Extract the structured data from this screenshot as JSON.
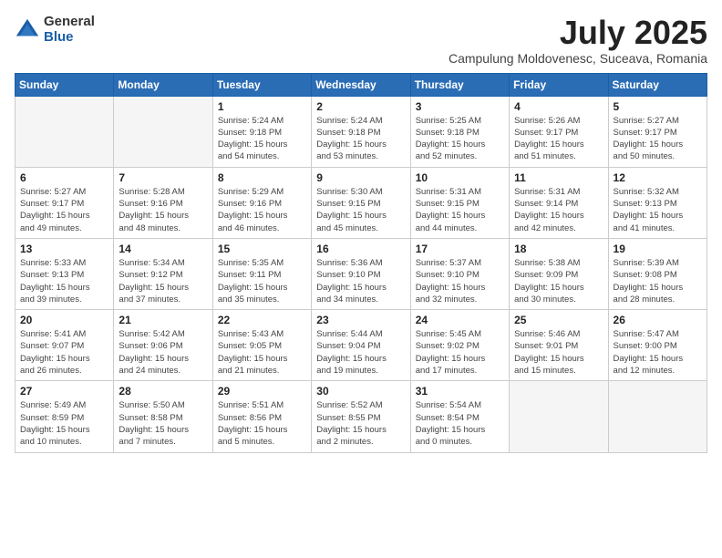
{
  "logo": {
    "general": "General",
    "blue": "Blue"
  },
  "title": "July 2025",
  "subtitle": "Campulung Moldovenesc, Suceava, Romania",
  "weekdays": [
    "Sunday",
    "Monday",
    "Tuesday",
    "Wednesday",
    "Thursday",
    "Friday",
    "Saturday"
  ],
  "weeks": [
    [
      {
        "day": "",
        "info": ""
      },
      {
        "day": "",
        "info": ""
      },
      {
        "day": "1",
        "info": "Sunrise: 5:24 AM\nSunset: 9:18 PM\nDaylight: 15 hours\nand 54 minutes."
      },
      {
        "day": "2",
        "info": "Sunrise: 5:24 AM\nSunset: 9:18 PM\nDaylight: 15 hours\nand 53 minutes."
      },
      {
        "day": "3",
        "info": "Sunrise: 5:25 AM\nSunset: 9:18 PM\nDaylight: 15 hours\nand 52 minutes."
      },
      {
        "day": "4",
        "info": "Sunrise: 5:26 AM\nSunset: 9:17 PM\nDaylight: 15 hours\nand 51 minutes."
      },
      {
        "day": "5",
        "info": "Sunrise: 5:27 AM\nSunset: 9:17 PM\nDaylight: 15 hours\nand 50 minutes."
      }
    ],
    [
      {
        "day": "6",
        "info": "Sunrise: 5:27 AM\nSunset: 9:17 PM\nDaylight: 15 hours\nand 49 minutes."
      },
      {
        "day": "7",
        "info": "Sunrise: 5:28 AM\nSunset: 9:16 PM\nDaylight: 15 hours\nand 48 minutes."
      },
      {
        "day": "8",
        "info": "Sunrise: 5:29 AM\nSunset: 9:16 PM\nDaylight: 15 hours\nand 46 minutes."
      },
      {
        "day": "9",
        "info": "Sunrise: 5:30 AM\nSunset: 9:15 PM\nDaylight: 15 hours\nand 45 minutes."
      },
      {
        "day": "10",
        "info": "Sunrise: 5:31 AM\nSunset: 9:15 PM\nDaylight: 15 hours\nand 44 minutes."
      },
      {
        "day": "11",
        "info": "Sunrise: 5:31 AM\nSunset: 9:14 PM\nDaylight: 15 hours\nand 42 minutes."
      },
      {
        "day": "12",
        "info": "Sunrise: 5:32 AM\nSunset: 9:13 PM\nDaylight: 15 hours\nand 41 minutes."
      }
    ],
    [
      {
        "day": "13",
        "info": "Sunrise: 5:33 AM\nSunset: 9:13 PM\nDaylight: 15 hours\nand 39 minutes."
      },
      {
        "day": "14",
        "info": "Sunrise: 5:34 AM\nSunset: 9:12 PM\nDaylight: 15 hours\nand 37 minutes."
      },
      {
        "day": "15",
        "info": "Sunrise: 5:35 AM\nSunset: 9:11 PM\nDaylight: 15 hours\nand 35 minutes."
      },
      {
        "day": "16",
        "info": "Sunrise: 5:36 AM\nSunset: 9:10 PM\nDaylight: 15 hours\nand 34 minutes."
      },
      {
        "day": "17",
        "info": "Sunrise: 5:37 AM\nSunset: 9:10 PM\nDaylight: 15 hours\nand 32 minutes."
      },
      {
        "day": "18",
        "info": "Sunrise: 5:38 AM\nSunset: 9:09 PM\nDaylight: 15 hours\nand 30 minutes."
      },
      {
        "day": "19",
        "info": "Sunrise: 5:39 AM\nSunset: 9:08 PM\nDaylight: 15 hours\nand 28 minutes."
      }
    ],
    [
      {
        "day": "20",
        "info": "Sunrise: 5:41 AM\nSunset: 9:07 PM\nDaylight: 15 hours\nand 26 minutes."
      },
      {
        "day": "21",
        "info": "Sunrise: 5:42 AM\nSunset: 9:06 PM\nDaylight: 15 hours\nand 24 minutes."
      },
      {
        "day": "22",
        "info": "Sunrise: 5:43 AM\nSunset: 9:05 PM\nDaylight: 15 hours\nand 21 minutes."
      },
      {
        "day": "23",
        "info": "Sunrise: 5:44 AM\nSunset: 9:04 PM\nDaylight: 15 hours\nand 19 minutes."
      },
      {
        "day": "24",
        "info": "Sunrise: 5:45 AM\nSunset: 9:02 PM\nDaylight: 15 hours\nand 17 minutes."
      },
      {
        "day": "25",
        "info": "Sunrise: 5:46 AM\nSunset: 9:01 PM\nDaylight: 15 hours\nand 15 minutes."
      },
      {
        "day": "26",
        "info": "Sunrise: 5:47 AM\nSunset: 9:00 PM\nDaylight: 15 hours\nand 12 minutes."
      }
    ],
    [
      {
        "day": "27",
        "info": "Sunrise: 5:49 AM\nSunset: 8:59 PM\nDaylight: 15 hours\nand 10 minutes."
      },
      {
        "day": "28",
        "info": "Sunrise: 5:50 AM\nSunset: 8:58 PM\nDaylight: 15 hours\nand 7 minutes."
      },
      {
        "day": "29",
        "info": "Sunrise: 5:51 AM\nSunset: 8:56 PM\nDaylight: 15 hours\nand 5 minutes."
      },
      {
        "day": "30",
        "info": "Sunrise: 5:52 AM\nSunset: 8:55 PM\nDaylight: 15 hours\nand 2 minutes."
      },
      {
        "day": "31",
        "info": "Sunrise: 5:54 AM\nSunset: 8:54 PM\nDaylight: 15 hours\nand 0 minutes."
      },
      {
        "day": "",
        "info": ""
      },
      {
        "day": "",
        "info": ""
      }
    ]
  ]
}
